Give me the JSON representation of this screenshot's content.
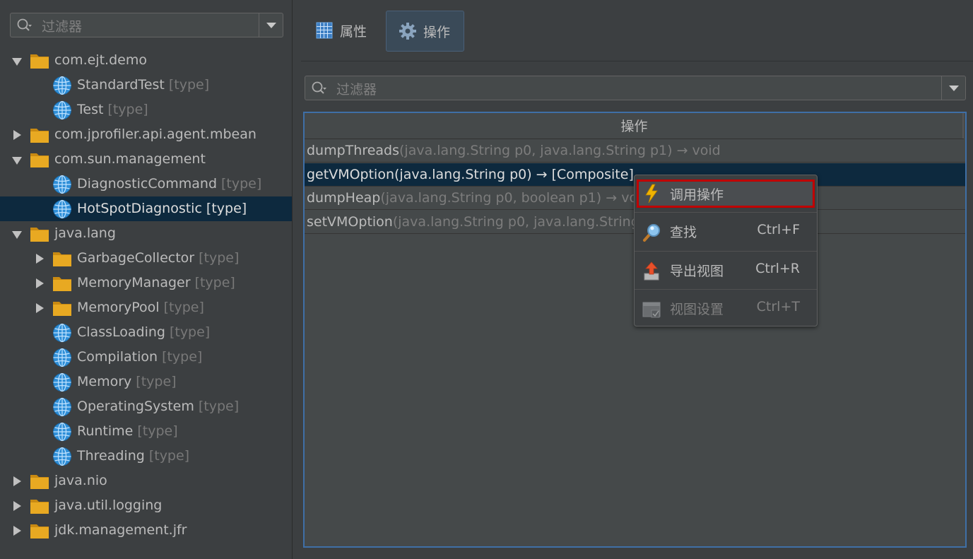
{
  "left_filter": {
    "placeholder": "过滤器"
  },
  "tree": [
    {
      "label": "com.ejt.demo",
      "type": "",
      "kind": "folder",
      "expand": "down",
      "indent": 0
    },
    {
      "label": "StandardTest",
      "type": "[type]",
      "kind": "globe",
      "expand": "",
      "indent": 1
    },
    {
      "label": "Test",
      "type": "[type]",
      "kind": "globe",
      "expand": "",
      "indent": 1
    },
    {
      "label": "com.jprofiler.api.agent.mbean",
      "type": "",
      "kind": "folder",
      "expand": "right",
      "indent": 0
    },
    {
      "label": "com.sun.management",
      "type": "",
      "kind": "folder",
      "expand": "down",
      "indent": 0
    },
    {
      "label": "DiagnosticCommand",
      "type": "[type]",
      "kind": "globe",
      "expand": "",
      "indent": 1
    },
    {
      "label": "HotSpotDiagnostic",
      "type": "[type]",
      "kind": "globe",
      "expand": "",
      "indent": 1,
      "selected": true
    },
    {
      "label": "java.lang",
      "type": "",
      "kind": "folder",
      "expand": "down",
      "indent": 0
    },
    {
      "label": "GarbageCollector",
      "type": "[type]",
      "kind": "folder",
      "expand": "right",
      "indent": 1
    },
    {
      "label": "MemoryManager",
      "type": "[type]",
      "kind": "folder",
      "expand": "right",
      "indent": 1
    },
    {
      "label": "MemoryPool",
      "type": "[type]",
      "kind": "folder",
      "expand": "right",
      "indent": 1
    },
    {
      "label": "ClassLoading",
      "type": "[type]",
      "kind": "globe",
      "expand": "",
      "indent": 1
    },
    {
      "label": "Compilation",
      "type": "[type]",
      "kind": "globe",
      "expand": "",
      "indent": 1
    },
    {
      "label": "Memory",
      "type": "[type]",
      "kind": "globe",
      "expand": "",
      "indent": 1
    },
    {
      "label": "OperatingSystem",
      "type": "[type]",
      "kind": "globe",
      "expand": "",
      "indent": 1
    },
    {
      "label": "Runtime",
      "type": "[type]",
      "kind": "globe",
      "expand": "",
      "indent": 1
    },
    {
      "label": "Threading",
      "type": "[type]",
      "kind": "globe",
      "expand": "",
      "indent": 1
    },
    {
      "label": "java.nio",
      "type": "",
      "kind": "folder",
      "expand": "right",
      "indent": 0
    },
    {
      "label": "java.util.logging",
      "type": "",
      "kind": "folder",
      "expand": "right",
      "indent": 0
    },
    {
      "label": "jdk.management.jfr",
      "type": "",
      "kind": "folder",
      "expand": "right",
      "indent": 0
    }
  ],
  "tabs": [
    {
      "label": "属性",
      "icon": "grid-icon",
      "active": false
    },
    {
      "label": "操作",
      "icon": "gear-icon",
      "active": true
    }
  ],
  "ops_filter": {
    "placeholder": "过滤器"
  },
  "ops_table": {
    "header": "操作",
    "rows": [
      {
        "name": "dumpThreads",
        "sig": "(java.lang.String p0, java.lang.String p1) → void",
        "selected": false
      },
      {
        "name": "getVMOption(java.lang.String p0) → [Composite]",
        "sig": "",
        "selected": true
      },
      {
        "name": "dumpHeap",
        "sig": "(java.lang.String p0, boolean p1) → void",
        "selected": false
      },
      {
        "name": "setVMOption",
        "sig": "(java.lang.String p0, java.lang.String p1) → void",
        "selected": false
      }
    ]
  },
  "context_menu": {
    "items": [
      {
        "label": "调用操作",
        "shortcut": "",
        "icon": "lightning-icon",
        "highlighted": true,
        "disabled": false
      },
      {
        "label": "查找",
        "shortcut": "Ctrl+F",
        "icon": "magnifier-icon",
        "highlighted": false,
        "disabled": false
      },
      {
        "label": "导出视图",
        "shortcut": "Ctrl+R",
        "icon": "export-icon",
        "highlighted": false,
        "disabled": false
      },
      {
        "label": "视图设置",
        "shortcut": "Ctrl+T",
        "icon": "view-settings-icon",
        "highlighted": false,
        "disabled": true
      }
    ]
  },
  "colors": {
    "accent_border": "#3f6fa6",
    "selection": "#0d293e",
    "highlight_box": "#c00000",
    "folder": "#e0a420"
  }
}
